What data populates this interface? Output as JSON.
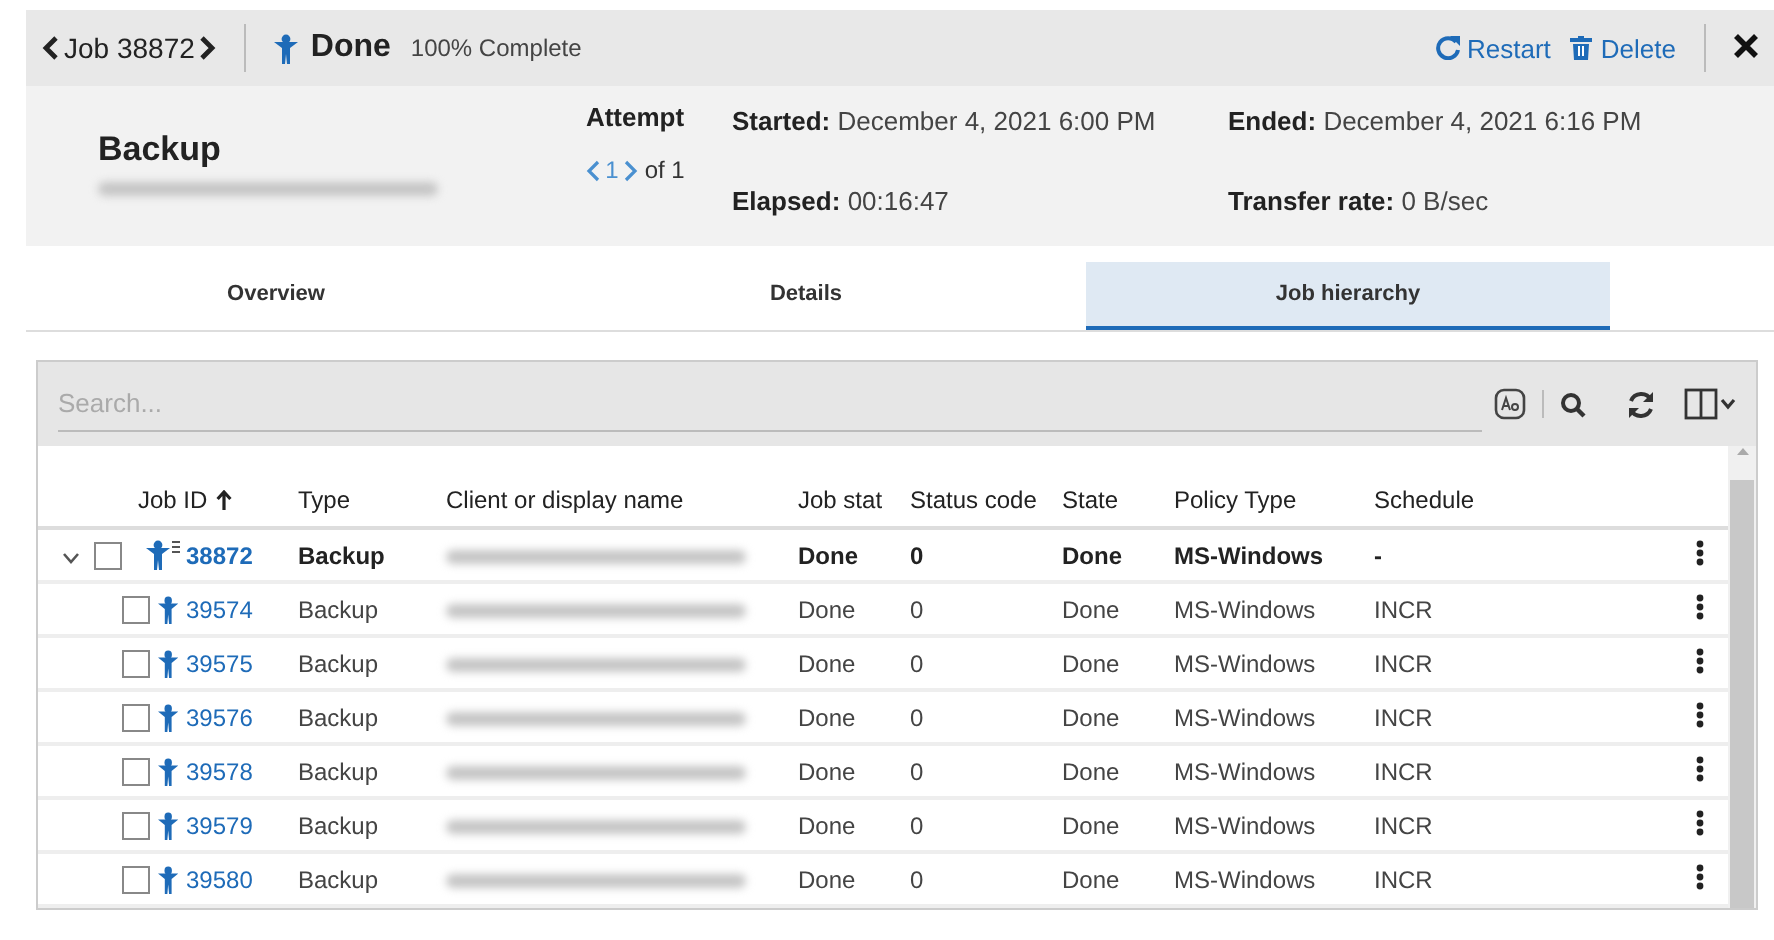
{
  "header": {
    "job_label": "Job 38872",
    "status": "Done",
    "progress": "100% Complete",
    "actions": [
      {
        "kind": "restart",
        "label": "Restart"
      },
      {
        "kind": "delete",
        "label": "Delete"
      }
    ]
  },
  "summary": {
    "title": "Backup",
    "attempt_label": "Attempt",
    "attempt_current": "1",
    "attempt_total": "of 1",
    "fields": [
      {
        "label": "Started:",
        "value": "December 4, 2021 6:00 PM"
      },
      {
        "label": "Elapsed:",
        "value": "00:16:47"
      },
      {
        "label": "Ended:",
        "value": "December 4, 2021 6:16 PM"
      },
      {
        "label": "Transfer rate:",
        "value": "0 B/sec"
      }
    ]
  },
  "tabs": [
    {
      "label": "Overview",
      "selected": false
    },
    {
      "label": "Details",
      "selected": false
    },
    {
      "label": "Job hierarchy",
      "selected": true
    }
  ],
  "search": {
    "placeholder": "Search..."
  },
  "table": {
    "columns": [
      {
        "label": "Job ID",
        "sorted": true
      },
      {
        "label": "Type",
        "sorted": false
      },
      {
        "label": "Client or display name",
        "sorted": false
      },
      {
        "label": "Job stat",
        "sorted": false
      },
      {
        "label": "Status code",
        "sorted": false
      },
      {
        "label": "State",
        "sorted": false
      },
      {
        "label": "Policy Type",
        "sorted": false
      },
      {
        "label": "Schedule",
        "sorted": false
      }
    ],
    "rows": [
      {
        "job_id": "38872",
        "type": "Backup",
        "job_state": "Done",
        "status_code": "0",
        "state": "Done",
        "policy_type": "MS-Windows",
        "schedule": "-",
        "checked": false,
        "expanded": true,
        "children": [
          {
            "job_id": "39574",
            "type": "Backup",
            "job_state": "Done",
            "status_code": "0",
            "state": "Done",
            "policy_type": "MS-Windows",
            "schedule": "INCR",
            "checked": false
          },
          {
            "job_id": "39575",
            "type": "Backup",
            "job_state": "Done",
            "status_code": "0",
            "state": "Done",
            "policy_type": "MS-Windows",
            "schedule": "INCR",
            "checked": false
          },
          {
            "job_id": "39576",
            "type": "Backup",
            "job_state": "Done",
            "status_code": "0",
            "state": "Done",
            "policy_type": "MS-Windows",
            "schedule": "INCR",
            "checked": false
          },
          {
            "job_id": "39578",
            "type": "Backup",
            "job_state": "Done",
            "status_code": "0",
            "state": "Done",
            "policy_type": "MS-Windows",
            "schedule": "INCR",
            "checked": false
          },
          {
            "job_id": "39579",
            "type": "Backup",
            "job_state": "Done",
            "status_code": "0",
            "state": "Done",
            "policy_type": "MS-Windows",
            "schedule": "INCR",
            "checked": false
          },
          {
            "job_id": "39580",
            "type": "Backup",
            "job_state": "Done",
            "status_code": "0",
            "state": "Done",
            "policy_type": "MS-Windows",
            "schedule": "INCR",
            "checked": false
          }
        ]
      }
    ]
  }
}
